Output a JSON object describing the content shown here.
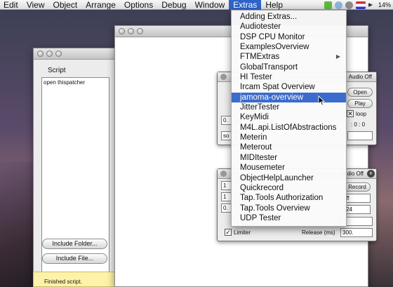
{
  "menubar": {
    "items": [
      "Edit",
      "View",
      "Object",
      "Arrange",
      "Options",
      "Debug",
      "Window",
      "Extras",
      "Help"
    ],
    "active": "Extras",
    "battery": "14%",
    "colors": {
      "highlight": "#2f63c8"
    }
  },
  "extras_menu": {
    "items": [
      {
        "label": "Adding Extras...",
        "submenu": false
      },
      {
        "label": "Audiotester",
        "submenu": false
      },
      {
        "label": "DSP CPU Monitor",
        "submenu": false
      },
      {
        "label": "ExamplesOverview",
        "submenu": false
      },
      {
        "label": "FTMExtras",
        "submenu": true
      },
      {
        "label": "GlobalTransport",
        "submenu": false
      },
      {
        "label": "HI Tester",
        "submenu": false
      },
      {
        "label": "Ircam Spat Overview",
        "submenu": false
      },
      {
        "label": "jamoma-overview",
        "submenu": false,
        "highlighted": true
      },
      {
        "label": "JitterTester",
        "submenu": false
      },
      {
        "label": "KeyMidi",
        "submenu": false
      },
      {
        "label": "M4L.api.ListOfAbstractions",
        "submenu": false
      },
      {
        "label": "Meterin",
        "submenu": false
      },
      {
        "label": "Meterout",
        "submenu": false
      },
      {
        "label": "MIDItester",
        "submenu": false
      },
      {
        "label": "Mousemeter",
        "submenu": false
      },
      {
        "label": "ObjectHelpLauncher",
        "submenu": false
      },
      {
        "label": "Quickrecord",
        "submenu": false
      },
      {
        "label": "Tap.Tools Authorization",
        "submenu": false
      },
      {
        "label": "Tap.Tools Overview",
        "submenu": false
      },
      {
        "label": "UDP Tester",
        "submenu": false
      }
    ],
    "submenu_glyph": "▶"
  },
  "script_window": {
    "label": "Script",
    "content": "open thispatcher",
    "include_folder_label": "Include Folder...",
    "include_file_label": "Include File...",
    "status": "Finished script."
  },
  "panel_a": {
    "audio_off": "Audio Off",
    "open_label": "Open",
    "play_label": "Play",
    "loop_label": "loop",
    "time": ": 0 : 0",
    "number": "0.",
    "so_label": "so"
  },
  "panel_b": {
    "audio_off": "Audio Off",
    "record_label": "Record",
    "ff_label": "ff",
    "bits_label": "24",
    "num1": "1",
    "num2": "1",
    "num3": "0.",
    "limiter_label": "Limiter",
    "release_label": "Release (ms)",
    "release_value": "300."
  }
}
